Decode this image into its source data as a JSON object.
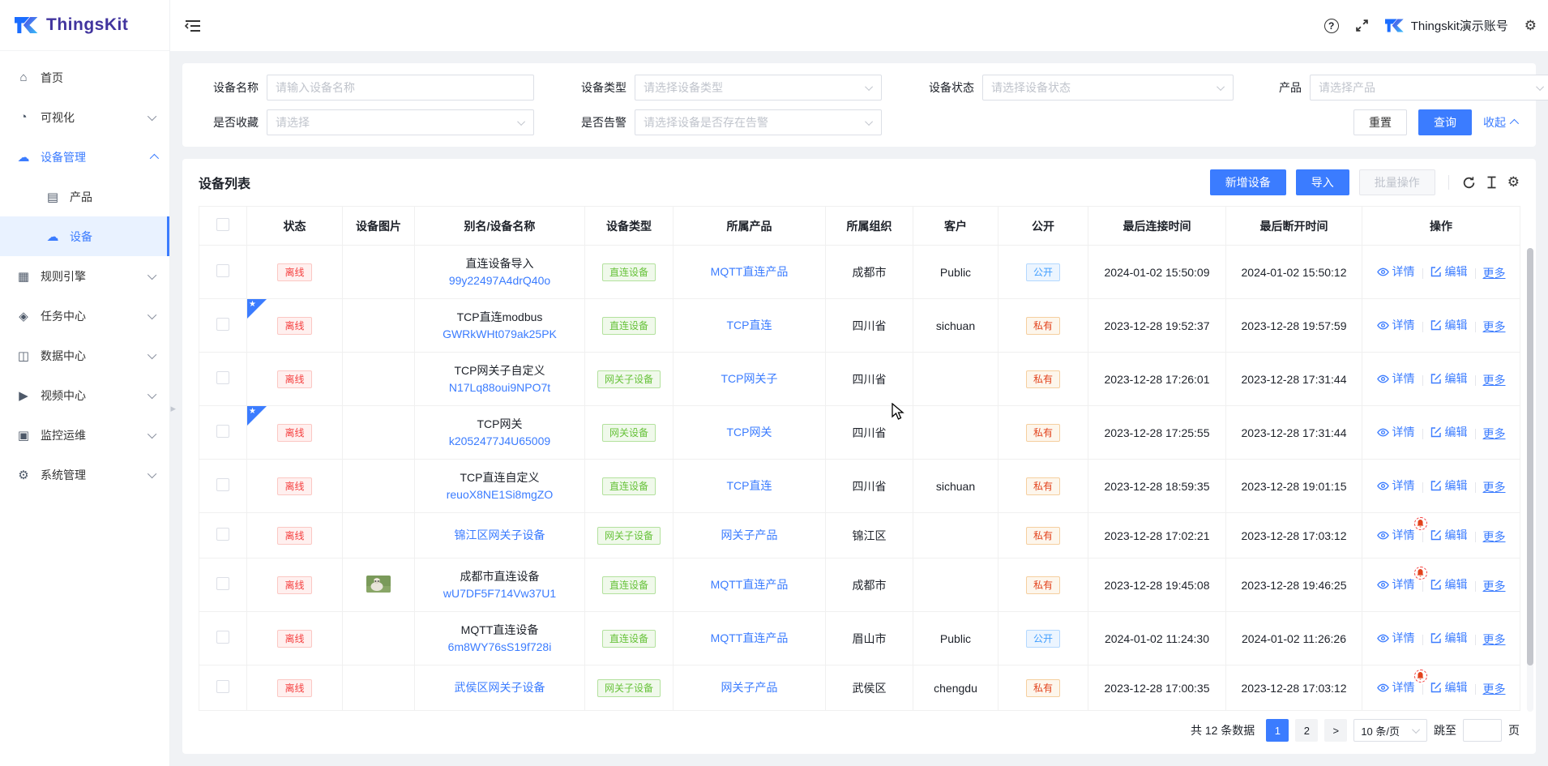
{
  "brand": {
    "name": "ThingsKit"
  },
  "topbar": {
    "account": "Thingskit演示账号"
  },
  "sidebar": {
    "items": [
      {
        "label": "首页",
        "icon": "home-icon"
      },
      {
        "label": "可视化",
        "icon": "visualization-icon"
      },
      {
        "label": "设备管理",
        "icon": "device-management-icon",
        "children": [
          {
            "label": "产品",
            "icon": "product-icon"
          },
          {
            "label": "设备",
            "icon": "device-icon"
          }
        ]
      },
      {
        "label": "规则引擎",
        "icon": "rule-engine-icon"
      },
      {
        "label": "任务中心",
        "icon": "task-center-icon"
      },
      {
        "label": "数据中心",
        "icon": "data-center-icon"
      },
      {
        "label": "视频中心",
        "icon": "video-center-icon"
      },
      {
        "label": "监控运维",
        "icon": "monitoring-icon"
      },
      {
        "label": "系统管理",
        "icon": "system-management-icon"
      }
    ]
  },
  "filters": {
    "device_name": {
      "label": "设备名称",
      "placeholder": "请输入设备名称"
    },
    "device_type": {
      "label": "设备类型",
      "placeholder": "请选择设备类型"
    },
    "device_status": {
      "label": "设备状态",
      "placeholder": "请选择设备状态"
    },
    "product": {
      "label": "产品",
      "placeholder": "请选择产品"
    },
    "favorite": {
      "label": "是否收藏",
      "placeholder": "请选择"
    },
    "alarm": {
      "label": "是否告警",
      "placeholder": "请选择设备是否存在告警"
    },
    "reset": "重置",
    "query": "查询",
    "collapse": "收起"
  },
  "toolbar": {
    "title": "设备列表",
    "add_device": "新增设备",
    "import": "导入",
    "batch": "批量操作"
  },
  "table": {
    "columns": [
      "状态",
      "设备图片",
      "别名/设备名称",
      "设备类型",
      "所属产品",
      "所属组织",
      "客户",
      "公开",
      "最后连接时间",
      "最后断开时间",
      "操作"
    ],
    "actions": {
      "detail": "详情",
      "edit": "编辑",
      "more": "更多"
    },
    "rows": [
      {
        "starred": false,
        "status": "离线",
        "image": false,
        "name": "直连设备导入",
        "code": "99y22497A4drQ40o",
        "name_is_link": false,
        "type": "直连设备",
        "product": "MQTT直连产品",
        "org": "成都市",
        "customer": "Public",
        "visibility": "公开",
        "last_connect": "2024-01-02 15:50:09",
        "last_disconnect": "2024-01-02 15:50:12",
        "alarm": false
      },
      {
        "starred": true,
        "status": "离线",
        "image": false,
        "name": "TCP直连modbus",
        "code": "GWRkWHt079ak25PK",
        "name_is_link": false,
        "type": "直连设备",
        "product": "TCP直连",
        "org": "四川省",
        "customer": "sichuan",
        "visibility": "私有",
        "last_connect": "2023-12-28 19:52:37",
        "last_disconnect": "2023-12-28 19:57:59",
        "alarm": false
      },
      {
        "starred": false,
        "status": "离线",
        "image": false,
        "name": "TCP网关子自定义",
        "code": "N17Lq88oui9NPO7t",
        "name_is_link": false,
        "type": "网关子设备",
        "product": "TCP网关子",
        "org": "四川省",
        "customer": "",
        "visibility": "私有",
        "last_connect": "2023-12-28 17:26:01",
        "last_disconnect": "2023-12-28 17:31:44",
        "alarm": false
      },
      {
        "starred": true,
        "status": "离线",
        "image": false,
        "name": "TCP网关",
        "code": "k2052477J4U65009",
        "name_is_link": false,
        "type": "网关设备",
        "product": "TCP网关",
        "org": "四川省",
        "customer": "",
        "visibility": "私有",
        "last_connect": "2023-12-28 17:25:55",
        "last_disconnect": "2023-12-28 17:31:44",
        "alarm": false
      },
      {
        "starred": false,
        "status": "离线",
        "image": false,
        "name": "TCP直连自定义",
        "code": "reuoX8NE1Si8mgZO",
        "name_is_link": false,
        "type": "直连设备",
        "product": "TCP直连",
        "org": "四川省",
        "customer": "sichuan",
        "visibility": "私有",
        "last_connect": "2023-12-28 18:59:35",
        "last_disconnect": "2023-12-28 19:01:15",
        "alarm": false
      },
      {
        "starred": false,
        "status": "离线",
        "image": false,
        "name": "锦江区网关子设备",
        "code": "",
        "name_is_link": true,
        "type": "网关子设备",
        "product": "网关子产品",
        "org": "锦江区",
        "customer": "",
        "visibility": "私有",
        "last_connect": "2023-12-28 17:02:21",
        "last_disconnect": "2023-12-28 17:03:12",
        "alarm": true
      },
      {
        "starred": false,
        "status": "离线",
        "image": true,
        "name": "成都市直连设备",
        "code": "wU7DF5F714Vw37U1",
        "name_is_link": false,
        "type": "直连设备",
        "product": "MQTT直连产品",
        "org": "成都市",
        "customer": "",
        "visibility": "私有",
        "last_connect": "2023-12-28 19:45:08",
        "last_disconnect": "2023-12-28 19:46:25",
        "alarm": true
      },
      {
        "starred": false,
        "status": "离线",
        "image": false,
        "name": "MQTT直连设备",
        "code": "6m8WY76sS19f728i",
        "name_is_link": false,
        "type": "直连设备",
        "product": "MQTT直连产品",
        "org": "眉山市",
        "customer": "Public",
        "visibility": "公开",
        "last_connect": "2024-01-02 11:24:30",
        "last_disconnect": "2024-01-02 11:26:26",
        "alarm": false
      },
      {
        "starred": false,
        "status": "离线",
        "image": false,
        "name": "武侯区网关子设备",
        "code": "",
        "name_is_link": true,
        "type": "网关子设备",
        "product": "网关子产品",
        "org": "武侯区",
        "customer": "chengdu",
        "visibility": "私有",
        "last_connect": "2023-12-28 17:00:35",
        "last_disconnect": "2023-12-28 17:03:12",
        "alarm": true
      }
    ]
  },
  "pagination": {
    "total": "共 12 条数据",
    "page1": "1",
    "page2": "2",
    "next": ">",
    "page_size": "10 条/页",
    "jump_prefix": "跳至",
    "jump_suffix": "页"
  },
  "colors": {
    "primary": "#3b7cff",
    "danger": "#f53f3f",
    "success": "#67c23a",
    "warning": "#e2431d"
  }
}
